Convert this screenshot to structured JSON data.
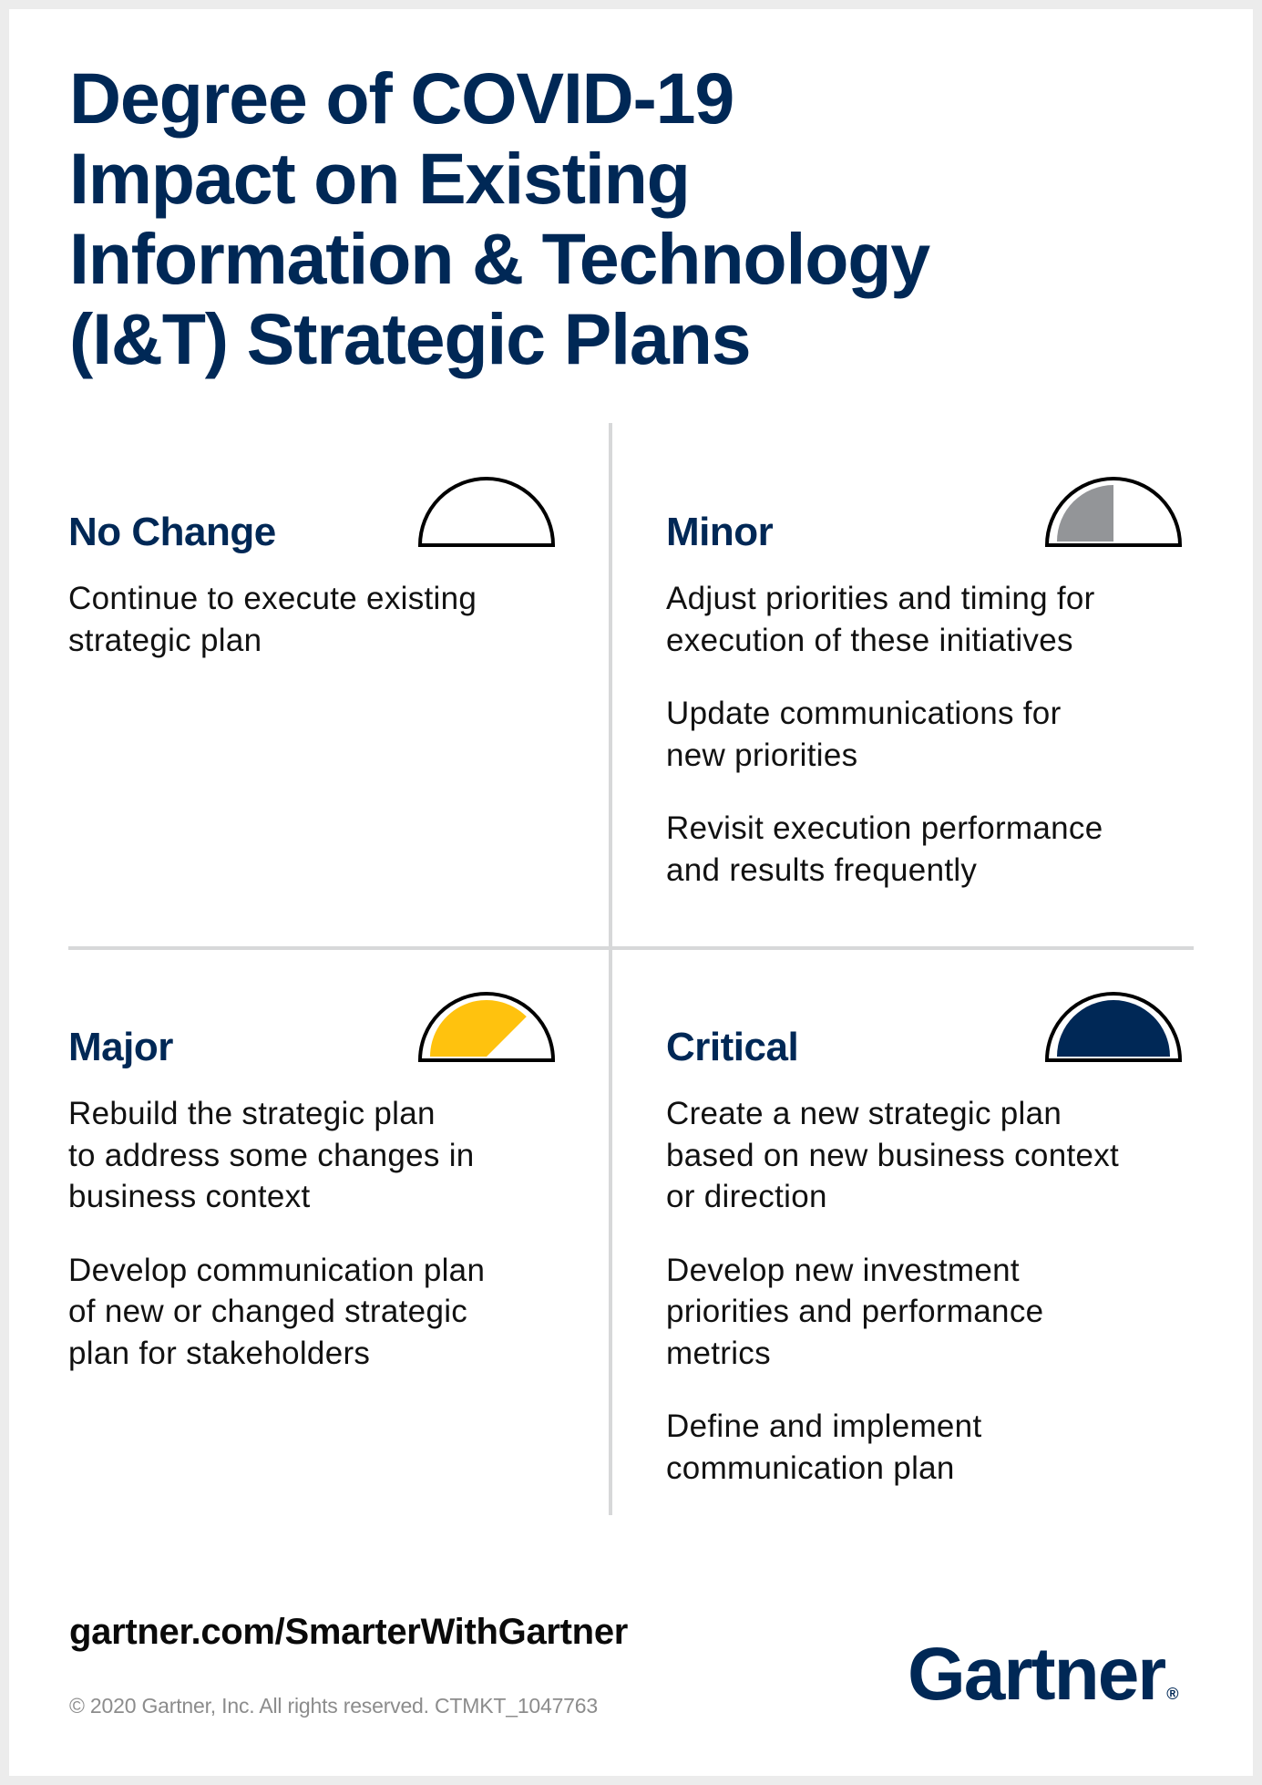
{
  "title": {
    "lines": [
      "Degree of COVID-19",
      "Impact on Existing",
      "Information & Technology",
      "(I&T) Strategic Plans"
    ]
  },
  "colors": {
    "navy": "#002856",
    "grey_fill": "#939598",
    "yellow_fill": "#FFC20E",
    "divider": "#D7D8D9",
    "frame": "#ECECEC"
  },
  "quadrants": [
    {
      "title": "No Change",
      "gauge": {
        "icon": "gauge-empty-icon",
        "fill_fraction": 0.0,
        "fill_color": "none"
      },
      "paragraphs": [
        [
          "Continue to execute existing",
          "strategic plan"
        ]
      ]
    },
    {
      "title": "Minor",
      "gauge": {
        "icon": "gauge-quarter-icon",
        "fill_fraction": 0.5,
        "fill_color": "#939598"
      },
      "paragraphs": [
        [
          "Adjust priorities and timing for",
          "execution of these initiatives"
        ],
        [
          "Update communications for",
          "new priorities"
        ],
        [
          "Revisit execution performance",
          "and results frequently"
        ]
      ]
    },
    {
      "title": "Major",
      "gauge": {
        "icon": "gauge-three-quarter-icon",
        "fill_fraction": 0.75,
        "fill_color": "#FFC20E"
      },
      "paragraphs": [
        [
          "Rebuild the strategic plan",
          "to address some changes in",
          "business context"
        ],
        [
          "Develop communication plan",
          "of new or changed strategic",
          "plan for stakeholders"
        ]
      ]
    },
    {
      "title": "Critical",
      "gauge": {
        "icon": "gauge-full-icon",
        "fill_fraction": 1.0,
        "fill_color": "#002856"
      },
      "paragraphs": [
        [
          "Create a new strategic plan",
          "based on new business context",
          "or direction"
        ],
        [
          "Develop new investment",
          "priorities and performance",
          "metrics"
        ],
        [
          "Define and implement",
          "communication plan"
        ]
      ]
    }
  ],
  "footer": {
    "url": "gartner.com/SmarterWithGartner",
    "copyright": "© 2020 Gartner, Inc. All rights reserved. CTMKT_1047763",
    "logo_text": "Gartner",
    "logo_mark": "®"
  }
}
